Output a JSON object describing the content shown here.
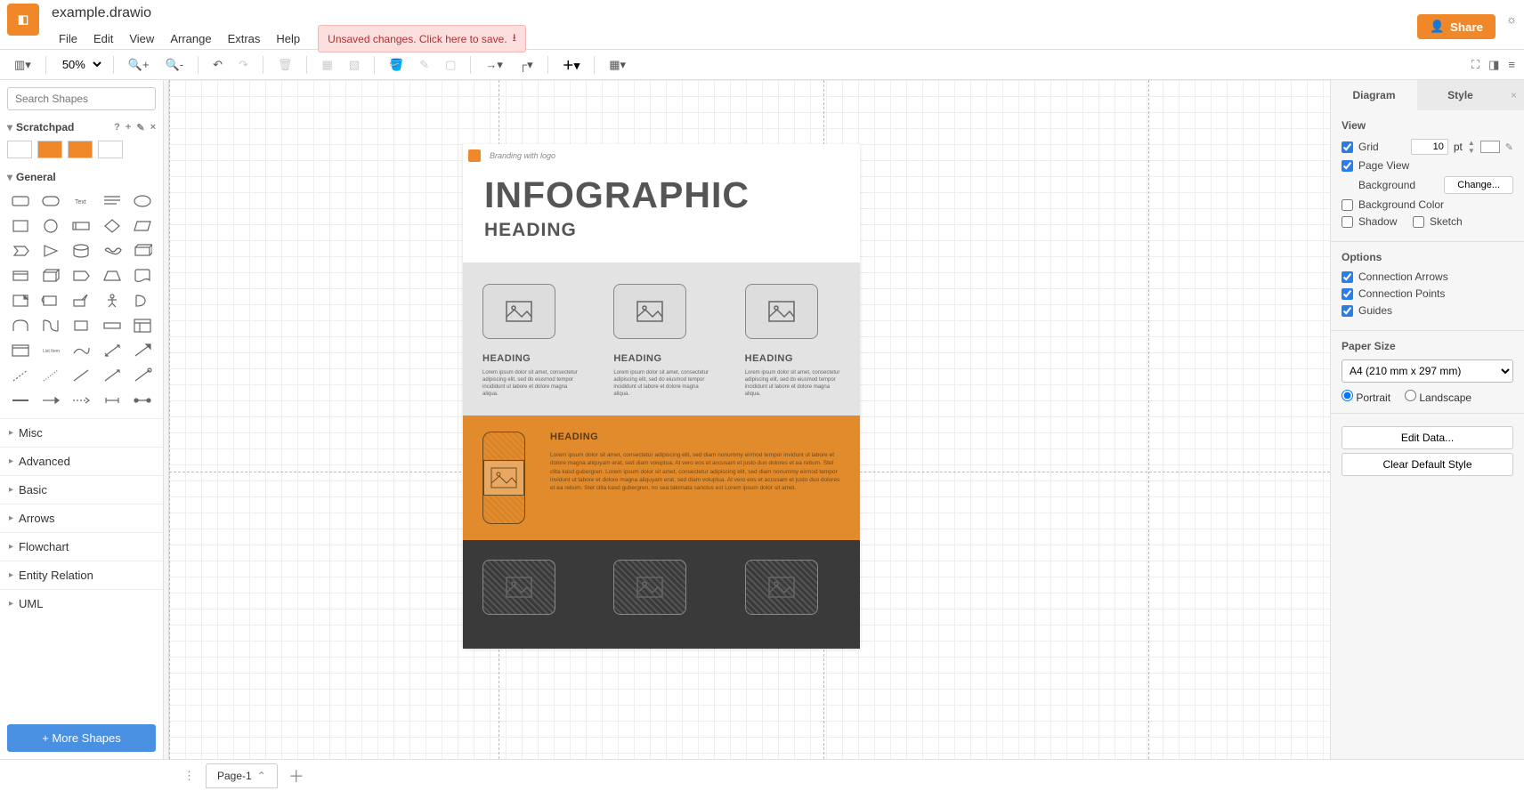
{
  "doc": {
    "title": "example.drawio"
  },
  "menu": {
    "file": "File",
    "edit": "Edit",
    "view": "View",
    "arrange": "Arrange",
    "extras": "Extras",
    "help": "Help"
  },
  "unsaved": "Unsaved changes. Click here to save.",
  "share": "Share",
  "zoom": "50%",
  "search_placeholder": "Search Shapes",
  "scratchpad": "Scratchpad",
  "general": "General",
  "categories": [
    "Misc",
    "Advanced",
    "Basic",
    "Arrows",
    "Flowchart",
    "Entity Relation",
    "UML"
  ],
  "more_shapes": "+ More Shapes",
  "page": {
    "brand": "Branding with logo",
    "title": "INFOGRAPHIC",
    "subtitle": "HEADING",
    "cards": [
      {
        "h": "HEADING",
        "p": "Lorem ipsum dolor sit amet, consectetur adipiscing elit, sed do eiusmod tempor incididunt ut labore et dolore magna aliqua."
      },
      {
        "h": "HEADING",
        "p": "Lorem ipsum dolor sit amet, consectetur adipiscing elit, sed do eiusmod tempor incididunt ut labore et dolore magna aliqua."
      },
      {
        "h": "HEADING",
        "p": "Lorem ipsum dolor sit amet, consectetur adipiscing elit, sed do eiusmod tempor incididunt ut labore et dolore magna aliqua."
      }
    ],
    "feature": {
      "h": "HEADING",
      "p": "Lorem ipsum dolor sit amet, consectetur adipiscing elit, sed diam nonummy eirmod tempor invidunt ut labore et dolore magna aliquyam erat, sed diam voluptua. At vero eos et accusam et justo duo dolores et ea rebum. Stet clita kasd gubergren. Lorem ipsum dolor sit amet, consectetur adipiscing elit, sed diam nonummy eirmod tempor invidunt ut labore et dolore magna aliquyam erat, sed diam voluptua. At vero eos et accusam et justo duo dolores et ea rebum. Stet clita kasd gubergren, no sea takimata sanctus est Lorem ipsum dolor sit amet."
    }
  },
  "right": {
    "tabs": {
      "diagram": "Diagram",
      "style": "Style"
    },
    "view_hdr": "View",
    "grid": "Grid",
    "grid_val": "10",
    "grid_unit": "pt",
    "page_view": "Page View",
    "background": "Background",
    "change": "Change...",
    "bg_color": "Background Color",
    "shadow": "Shadow",
    "sketch": "Sketch",
    "options_hdr": "Options",
    "conn_arrows": "Connection Arrows",
    "conn_points": "Connection Points",
    "guides": "Guides",
    "paper_hdr": "Paper Size",
    "paper": "A4 (210 mm x 297 mm)",
    "portrait": "Portrait",
    "landscape": "Landscape",
    "edit_data": "Edit Data...",
    "clear_style": "Clear Default Style"
  },
  "footer": {
    "page_tab": "Page-1"
  }
}
